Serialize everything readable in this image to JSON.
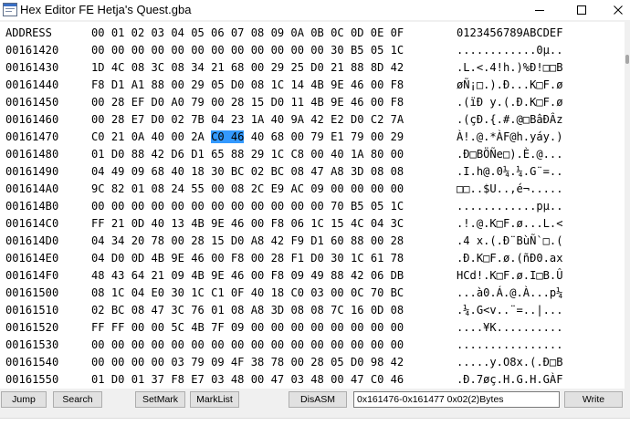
{
  "window": {
    "title": "Hex Editor FE Hetja's Quest.gba",
    "app_icon": "window-app-icon",
    "controls": {
      "minimize_icon": "minimize-icon",
      "maximize_icon": "maximize-icon",
      "close_icon": "close-icon"
    }
  },
  "header": {
    "address_label": "ADDRESS",
    "columns": "00 01 02 03 04 05 06 07 08 09 0A 0B 0C 0D 0E 0F",
    "ascii_header": "0123456789ABCDEF"
  },
  "rows": [
    {
      "address": "00161420",
      "bytes": [
        "00",
        "00",
        "00",
        "00",
        "00",
        "00",
        "00",
        "00",
        "00",
        "00",
        "00",
        "00",
        "30",
        "B5",
        "05",
        "1C"
      ],
      "ascii": "............0µ.."
    },
    {
      "address": "00161430",
      "bytes": [
        "1D",
        "4C",
        "08",
        "3C",
        "08",
        "34",
        "21",
        "68",
        "00",
        "29",
        "25",
        "D0",
        "21",
        "88",
        "8D",
        "42"
      ],
      "ascii": ".L.<.4!h.)%Ð!□□B"
    },
    {
      "address": "00161440",
      "bytes": [
        "F8",
        "D1",
        "A1",
        "88",
        "00",
        "29",
        "05",
        "D0",
        "08",
        "1C",
        "14",
        "4B",
        "9E",
        "46",
        "00",
        "F8"
      ],
      "ascii": "øÑ¡□.).Ð...K□F.ø"
    },
    {
      "address": "00161450",
      "bytes": [
        "00",
        "28",
        "EF",
        "D0",
        "A0",
        "79",
        "00",
        "28",
        "15",
        "D0",
        "11",
        "4B",
        "9E",
        "46",
        "00",
        "F8"
      ],
      "ascii": ".(ïÐ y.(.Ð.K□F.ø"
    },
    {
      "address": "00161460",
      "bytes": [
        "00",
        "28",
        "E7",
        "D0",
        "02",
        "7B",
        "04",
        "23",
        "1A",
        "40",
        "9A",
        "42",
        "E2",
        "D0",
        "C2",
        "7A"
      ],
      "ascii": ".(çÐ.{.#.@□BâÐÂz"
    },
    {
      "address": "00161470",
      "bytes": [
        "C0",
        "21",
        "0A",
        "40",
        "00",
        "2A",
        "C0",
        "46",
        "40",
        "68",
        "00",
        "79",
        "E1",
        "79",
        "00",
        "29"
      ],
      "ascii": "À!.@.*ÀF@h.yáy.)"
    },
    {
      "address": "00161480",
      "bytes": [
        "01",
        "D0",
        "88",
        "42",
        "D6",
        "D1",
        "65",
        "88",
        "29",
        "1C",
        "C8",
        "00",
        "40",
        "1A",
        "80",
        "00"
      ],
      "ascii": ".Ð□BÖÑe□).È.@..."
    },
    {
      "address": "00161490",
      "bytes": [
        "04",
        "49",
        "09",
        "68",
        "40",
        "18",
        "30",
        "BC",
        "02",
        "BC",
        "08",
        "47",
        "A8",
        "3D",
        "08",
        "08"
      ],
      "ascii": ".I.h@.0¼.¼.G¨=.."
    },
    {
      "address": "001614A0",
      "bytes": [
        "9C",
        "82",
        "01",
        "08",
        "24",
        "55",
        "00",
        "08",
        "2C",
        "E9",
        "AC",
        "09",
        "00",
        "00",
        "00",
        "00"
      ],
      "ascii": "□□..$U..,é¬....."
    },
    {
      "address": "001614B0",
      "bytes": [
        "00",
        "00",
        "00",
        "00",
        "00",
        "00",
        "00",
        "00",
        "00",
        "00",
        "00",
        "00",
        "70",
        "B5",
        "05",
        "1C"
      ],
      "ascii": "............pµ.."
    },
    {
      "address": "001614C0",
      "bytes": [
        "FF",
        "21",
        "0D",
        "40",
        "13",
        "4B",
        "9E",
        "46",
        "00",
        "F8",
        "06",
        "1C",
        "15",
        "4C",
        "04",
        "3C"
      ],
      "ascii": ".!.@.K□F.ø...L.<"
    },
    {
      "address": "001614D0",
      "bytes": [
        "04",
        "34",
        "20",
        "78",
        "00",
        "28",
        "15",
        "D0",
        "A8",
        "42",
        "F9",
        "D1",
        "60",
        "88",
        "00",
        "28"
      ],
      "ascii": ".4 x.(.Ð¨BùÑ`□.("
    },
    {
      "address": "001614E0",
      "bytes": [
        "04",
        "D0",
        "0D",
        "4B",
        "9E",
        "46",
        "00",
        "F8",
        "00",
        "28",
        "F1",
        "D0",
        "30",
        "1C",
        "61",
        "78"
      ],
      "ascii": ".Ð.K□F.ø.(ñÐ0.ax"
    },
    {
      "address": "001614F0",
      "bytes": [
        "48",
        "43",
        "64",
        "21",
        "09",
        "4B",
        "9E",
        "46",
        "00",
        "F8",
        "09",
        "49",
        "88",
        "42",
        "06",
        "DB"
      ],
      "ascii": "HCd!.K□F.ø.I□B.Û"
    },
    {
      "address": "00161500",
      "bytes": [
        "08",
        "1C",
        "04",
        "E0",
        "30",
        "1C",
        "C1",
        "0F",
        "40",
        "18",
        "C0",
        "03",
        "00",
        "0C",
        "70",
        "BC"
      ],
      "ascii": "...à0.Á.@.À...p¼"
    },
    {
      "address": "00161510",
      "bytes": [
        "02",
        "BC",
        "08",
        "47",
        "3C",
        "76",
        "01",
        "08",
        "A8",
        "3D",
        "08",
        "08",
        "7C",
        "16",
        "0D",
        "08"
      ],
      "ascii": ".¼.G<v..¨=..|..."
    },
    {
      "address": "00161520",
      "bytes": [
        "FF",
        "FF",
        "00",
        "00",
        "5C",
        "4B",
        "7F",
        "09",
        "00",
        "00",
        "00",
        "00",
        "00",
        "00",
        "00",
        "00"
      ],
      "ascii": "....¥K.........."
    },
    {
      "address": "00161530",
      "bytes": [
        "00",
        "00",
        "00",
        "00",
        "00",
        "00",
        "00",
        "00",
        "00",
        "00",
        "00",
        "00",
        "00",
        "00",
        "00",
        "00"
      ],
      "ascii": "................"
    },
    {
      "address": "00161540",
      "bytes": [
        "00",
        "00",
        "00",
        "00",
        "03",
        "79",
        "09",
        "4F",
        "38",
        "78",
        "00",
        "28",
        "05",
        "D0",
        "98",
        "42"
      ],
      "ascii": ".....y.O8x.(.Ð□B"
    },
    {
      "address": "00161550",
      "bytes": [
        "01",
        "D0",
        "01",
        "37",
        "F8",
        "E7",
        "03",
        "48",
        "00",
        "47",
        "03",
        "48",
        "00",
        "47",
        "C0",
        "46"
      ],
      "ascii": ".Ð.7øç.H.G.H.GÀF"
    },
    {
      "address": "00161560",
      "bytes": [
        "C0",
        "46",
        "C0",
        "46",
        "33",
        "75",
        "08",
        "08",
        "B7",
        "74",
        "08",
        "08",
        "1C",
        "44",
        "94",
        "09"
      ],
      "ascii": "ÀFÀF3u...t...D□."
    },
    {
      "address": "00161570",
      "bytes": [
        "00",
        "79",
        "07",
        "4B",
        "19",
        "78",
        "00",
        "29",
        "05",
        "D0",
        "88",
        "42",
        "01",
        "D0",
        "01",
        "33"
      ],
      "ascii": ".y.K.x.).Ð□B.Ð.3"
    }
  ],
  "selection": {
    "row": 5,
    "byte_start": 6,
    "byte_end": 7
  },
  "toolbar": {
    "jump_label": "Jump",
    "search_label": "Search",
    "setmark_label": "SetMark",
    "marklist_label": "MarkList",
    "disasm_label": "DisASM",
    "range_value": "0x161476-0x161477 0x02(2)Bytes",
    "write_label": "Write"
  },
  "colors": {
    "selection": "#3399ff",
    "background": "#ffffff",
    "chrome": "#f0f0f0"
  }
}
